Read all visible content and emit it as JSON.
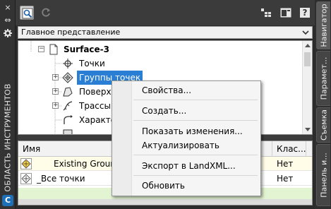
{
  "palette": {
    "toolbar_bg": "#3b3b3b",
    "selection": "#2a7fd4",
    "autocad_blue": "#1d6fb8",
    "row_highlight": "#fffde8",
    "list_green": "#e2f4d2"
  },
  "left_strip": {
    "close_icon": "×",
    "pin_icon": "⇔",
    "settings_icon": "gear",
    "title": "ОБЛАСТЬ ИНСТРУМЕНТОВ",
    "logo_letter": "C"
  },
  "toolbar": {
    "icons": [
      "select-item-icon",
      "refresh-icon",
      "multi-view-icon",
      "panel-icon",
      "help-icon"
    ],
    "help_label": "?"
  },
  "view_select": {
    "value": "Главное представление"
  },
  "tree": {
    "items": [
      {
        "label": "Surface-3",
        "bold": true,
        "expander": "−"
      },
      {
        "label": "Точки"
      },
      {
        "label": "Группы точек",
        "selected": true,
        "expander": "+"
      },
      {
        "label": "Поверхн",
        "expander": "+"
      },
      {
        "label": "Трассы",
        "expander": "+"
      },
      {
        "label": "Характер"
      }
    ]
  },
  "list": {
    "columns": [
      "Имя",
      "Клас..."
    ],
    "rows": [
      {
        "name": "Existing Ground Po",
        "class": "Нет"
      },
      {
        "name": "_Все точки",
        "class": "Нет"
      }
    ]
  },
  "context_menu": {
    "items": [
      "Свойства...",
      "Создать...",
      "Показать изменения...",
      "Актуализировать",
      "Экспорт в LandXML...",
      "Обновить"
    ]
  },
  "right_tabs": [
    "Навигатор",
    "Парамет...",
    "Съемка",
    "Панель и..."
  ]
}
